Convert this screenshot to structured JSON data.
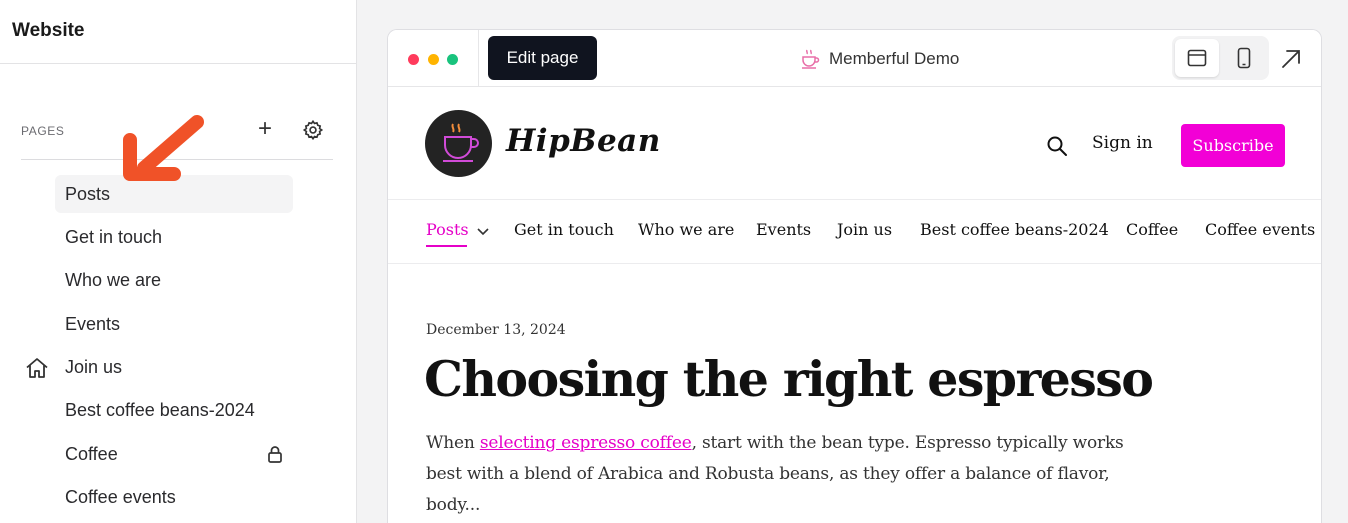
{
  "sidebar": {
    "title": "Website",
    "pages_heading": "PAGES",
    "add_label": "+",
    "items": [
      {
        "label": "Posts"
      },
      {
        "label": "Get in touch"
      },
      {
        "label": "Who we are"
      },
      {
        "label": "Events"
      },
      {
        "label": "Join us"
      },
      {
        "label": "Best coffee beans-2024"
      },
      {
        "label": "Coffee"
      },
      {
        "label": "Coffee events"
      }
    ]
  },
  "preview": {
    "edit_button": "Edit page",
    "site_name": "Memberful Demo",
    "window_dot_colors": [
      "#ff3b5c",
      "#ffb400",
      "#19c37d"
    ],
    "view_icons": [
      "desktop-icon",
      "mobile-icon"
    ],
    "open_icon": "external-arrow-icon"
  },
  "site": {
    "logo_text": "HipBean",
    "sign_in": "Sign in",
    "subscribe": "Subscribe",
    "accent_color": "#e500c8",
    "nav": [
      "Posts",
      "Get in touch",
      "Who we are",
      "Events",
      "Join us",
      "Best coffee beans-2024",
      "Coffee",
      "Coffee events"
    ]
  },
  "post": {
    "date": "December 13, 2024",
    "title": "Choosing the right espresso",
    "excerpt_before": "When ",
    "excerpt_link": "selecting espresso coffee",
    "excerpt_after": ", start with the bean type. Espresso typically works best with a blend of Arabica and Robusta beans, as they offer a balance of flavor, body..."
  }
}
